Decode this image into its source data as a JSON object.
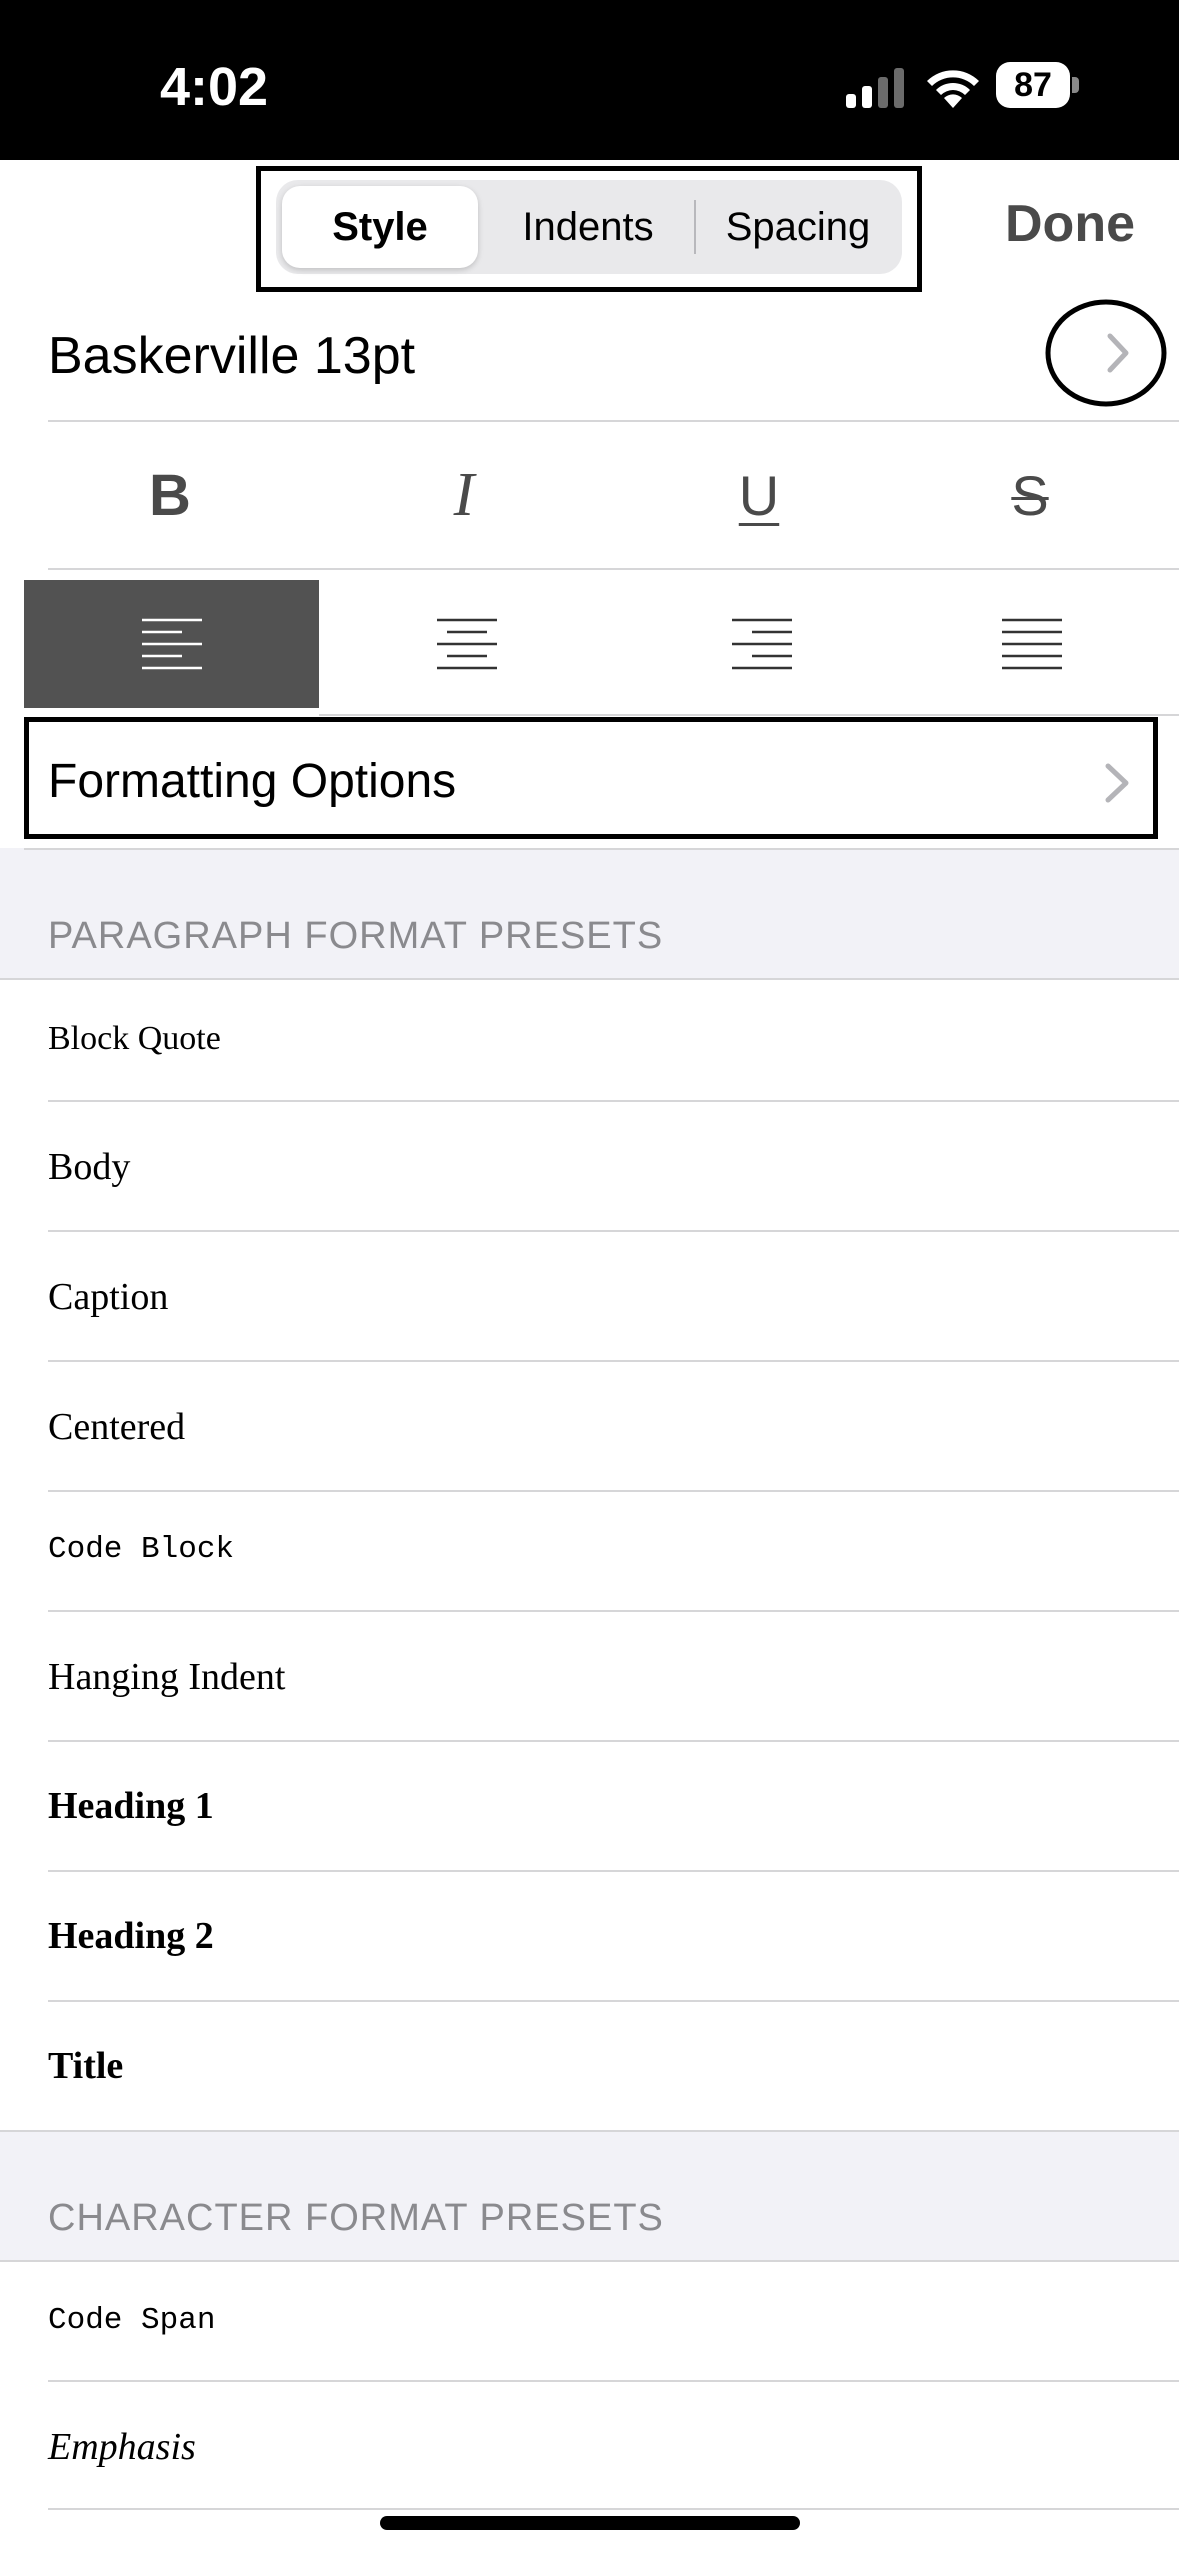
{
  "status_bar": {
    "time": "4:02",
    "battery": "87"
  },
  "header": {
    "segments": [
      "Style",
      "Indents",
      "Spacing"
    ],
    "selected_segment": "Style",
    "done_label": "Done"
  },
  "font": {
    "name": "Baskerville 13pt"
  },
  "style_buttons": {
    "bold": "B",
    "italic": "I",
    "underline": "U",
    "strikethrough": "S"
  },
  "alignment": {
    "selected": "left"
  },
  "formatting_options": {
    "label": "Formatting Options"
  },
  "paragraph_presets": {
    "title": "PARAGRAPH FORMAT PRESETS",
    "items": [
      "Block Quote",
      "Body",
      "Caption",
      "Centered",
      "Code Block",
      "Hanging Indent",
      "Heading 1",
      "Heading 2",
      "Title"
    ]
  },
  "character_presets": {
    "title": "CHARACTER FORMAT PRESETS",
    "items": [
      "Code Span",
      "Emphasis"
    ]
  },
  "colors": {
    "selected_align_bg": "#525252",
    "section_bg": "#f2f2f7",
    "secondary_text": "#8a8a8e"
  }
}
